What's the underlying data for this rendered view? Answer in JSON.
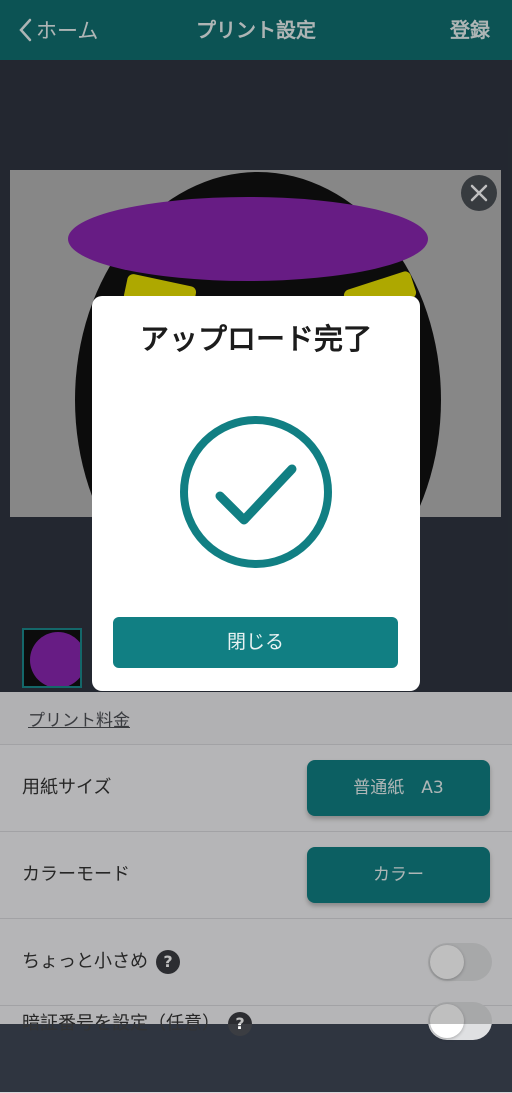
{
  "nav": {
    "back_label": "ホーム",
    "title": "プリント設定",
    "register_label": "登録"
  },
  "preview": {
    "image": "uploaded-photo-redacted",
    "close_icon": "close-icon"
  },
  "dialog": {
    "title": "アップロード完了",
    "icon": "checkmark-circle-icon",
    "close_label": "閉じる"
  },
  "settings": {
    "fee_link": "プリント料金",
    "paper_size": {
      "label": "用紙サイズ",
      "value": "普通紙　A3"
    },
    "color_mode": {
      "label": "カラーモード",
      "value": "カラー"
    },
    "reduce": {
      "label": "ちょっと小さめ",
      "on": false
    },
    "pin": {
      "label": "暗証番号を設定（任意）",
      "on": false
    }
  },
  "colors": {
    "accent": "#117f83",
    "header": "#116f71",
    "dialog_bg": "#ffffff",
    "background": "#2f3540"
  }
}
